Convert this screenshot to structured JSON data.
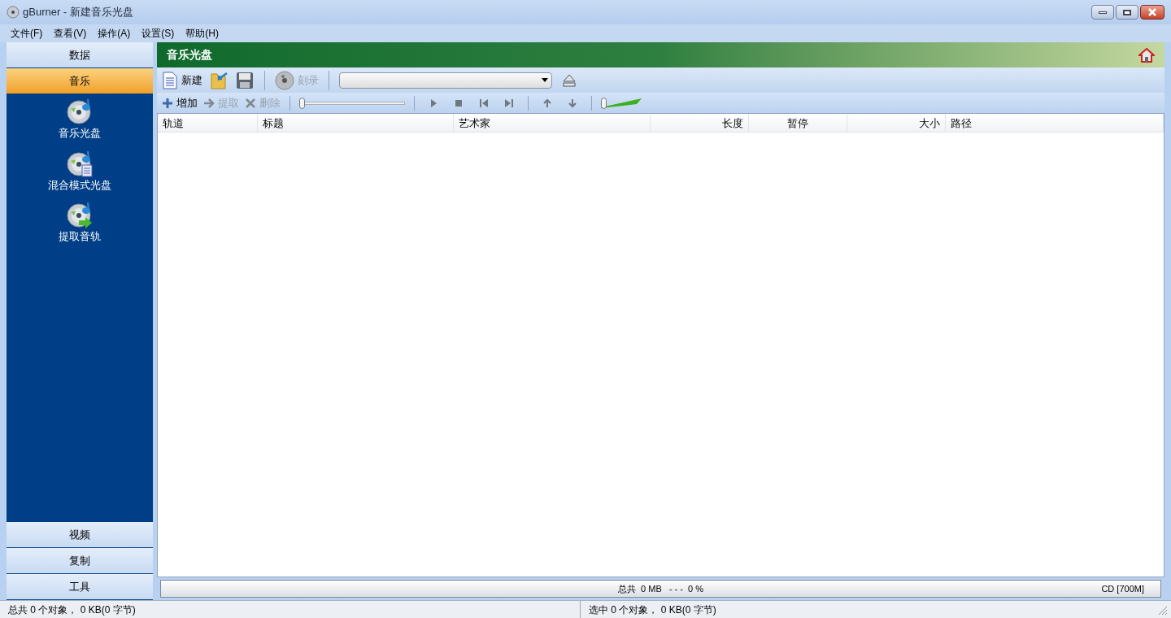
{
  "window": {
    "title": "gBurner - 新建音乐光盘"
  },
  "menu": [
    {
      "label": "文件(F)"
    },
    {
      "label": "查看(V)"
    },
    {
      "label": "操作(A)"
    },
    {
      "label": "设置(S)"
    },
    {
      "label": "帮助(H)"
    }
  ],
  "sidebar": {
    "top_categories": [
      {
        "label": "数据",
        "selected": false
      },
      {
        "label": "音乐",
        "selected": true
      }
    ],
    "items": [
      {
        "label": "音乐光盘",
        "kind": "music"
      },
      {
        "label": "混合模式光盘",
        "kind": "mixed"
      },
      {
        "label": "提取音轨",
        "kind": "rip"
      }
    ],
    "bottom_categories": [
      {
        "label": "视频",
        "selected": false
      },
      {
        "label": "复制",
        "selected": false
      },
      {
        "label": "工具",
        "selected": false
      }
    ]
  },
  "panel": {
    "title": "音乐光盘"
  },
  "toolbar": [
    {
      "kind": "new",
      "label": "新建",
      "disabled": false
    },
    {
      "kind": "open"
    },
    {
      "kind": "save"
    },
    {
      "kind": "separator"
    },
    {
      "kind": "burn",
      "label": "刻录",
      "disabled": true
    },
    {
      "kind": "separator"
    },
    {
      "kind": "dropdown"
    },
    {
      "kind": "eject"
    }
  ],
  "track_toolbar": [
    {
      "kind": "add",
      "label": "增加",
      "disabled": false
    },
    {
      "kind": "extract",
      "label": "提取",
      "disabled": true
    },
    {
      "kind": "delete",
      "label": "删除",
      "disabled": true
    },
    {
      "kind": "separator"
    },
    {
      "kind": "seek",
      "level": 0
    },
    {
      "kind": "separator"
    },
    {
      "kind": "play"
    },
    {
      "kind": "stop"
    },
    {
      "kind": "previous"
    },
    {
      "kind": "next"
    },
    {
      "kind": "separator"
    },
    {
      "kind": "up"
    },
    {
      "kind": "down"
    },
    {
      "kind": "separator"
    },
    {
      "kind": "volume",
      "level": 0
    }
  ],
  "table": {
    "columns": [
      {
        "label": "轨道"
      },
      {
        "label": "标题"
      },
      {
        "label": "艺术家"
      },
      {
        "label": "长度"
      },
      {
        "label": "暂停"
      },
      {
        "label": "大小"
      },
      {
        "label": "路径"
      }
    ]
  },
  "capacity": {
    "summary": "总共  0 MB   - - -  0 %",
    "disc": "CD [700M]",
    "level": 0
  },
  "status_bar": [
    "总共 0 个对象， 0 KB(0 字节)",
    "选中 0 个对象， 0 KB(0 字节)"
  ]
}
